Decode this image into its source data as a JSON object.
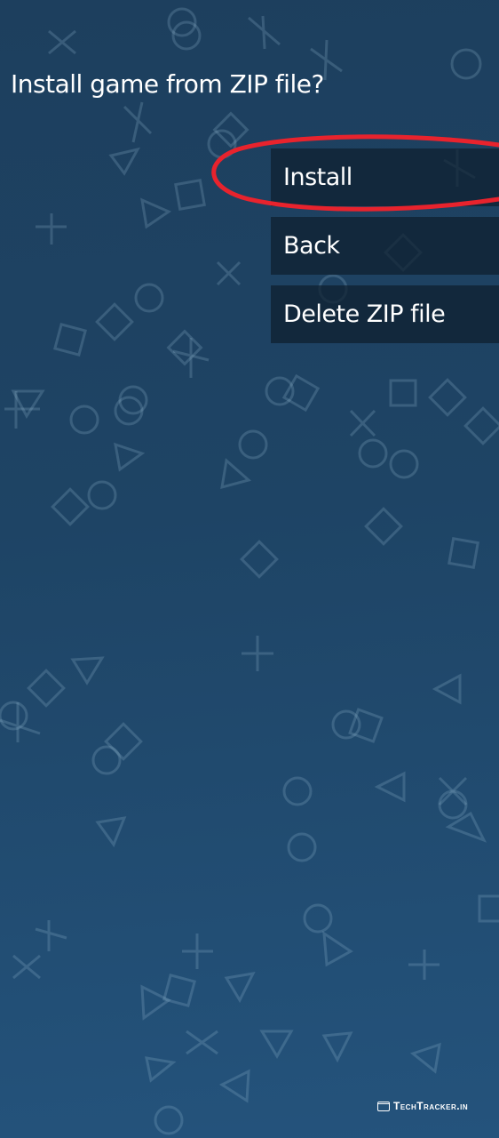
{
  "dialog": {
    "prompt": "Install game from ZIP file?"
  },
  "menu": {
    "items": [
      {
        "label": "Install"
      },
      {
        "label": "Back"
      },
      {
        "label": "Delete ZIP file"
      }
    ]
  },
  "annotation": {
    "color": "#e8232d",
    "highlights": "Install"
  },
  "watermark": {
    "text": "TechTracker.in"
  },
  "background": {
    "pattern_icons": [
      "cross-icon",
      "circle-icon",
      "square-icon",
      "triangle-icon"
    ]
  }
}
